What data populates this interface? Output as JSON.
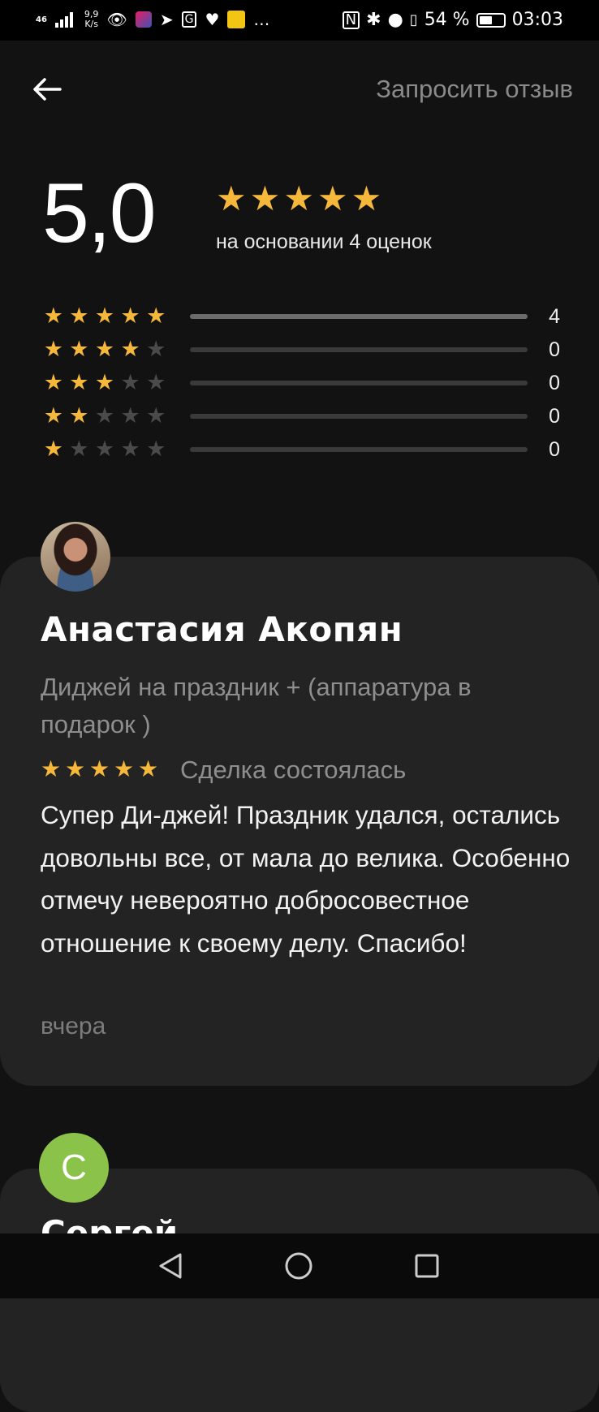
{
  "status_bar": {
    "network": "46",
    "speed_value": "9,9",
    "speed_unit": "K/s",
    "battery": "54 %",
    "battery_level": 0.54,
    "time": "03:03",
    "icons": [
      "signal-icon",
      "eye-icon",
      "app-icon",
      "location-arrow-icon",
      "translate-icon",
      "heart-monitor-icon",
      "notification-icon",
      "more-icon",
      "nfc-icon",
      "bluetooth-icon",
      "location-icon",
      "vibrate-icon",
      "battery-icon"
    ]
  },
  "header": {
    "back_icon": "arrow-left-icon",
    "request_review": "Запросить отзыв"
  },
  "summary": {
    "rating": "5,0",
    "stars": 5,
    "basis": "на основании 4 оценок"
  },
  "distribution": [
    {
      "stars": 5,
      "count": "4",
      "fraction": 1.0
    },
    {
      "stars": 4,
      "count": "0",
      "fraction": 0
    },
    {
      "stars": 3,
      "count": "0",
      "fraction": 0
    },
    {
      "stars": 2,
      "count": "0",
      "fraction": 0
    },
    {
      "stars": 1,
      "count": "0",
      "fraction": 0
    }
  ],
  "reviews": [
    {
      "name": "Анастасия Акопян",
      "service": "Диджей на праздник + (аппаратура в подарок )",
      "rating": 5,
      "status": "Сделка состоялась",
      "text": "Супер Ди-джей! Праздник удался, остались довольны все, от мала до велика. Особенно отмечу невероятно добросовестное отношение к своему делу. Спасибо!",
      "date": "вчера"
    },
    {
      "avatar_letter": "С",
      "name": "Сергей"
    }
  ],
  "colors": {
    "background": "#121212",
    "card": "#232323",
    "star": "#f6b83a",
    "avatar_green": "#8bc34a"
  }
}
